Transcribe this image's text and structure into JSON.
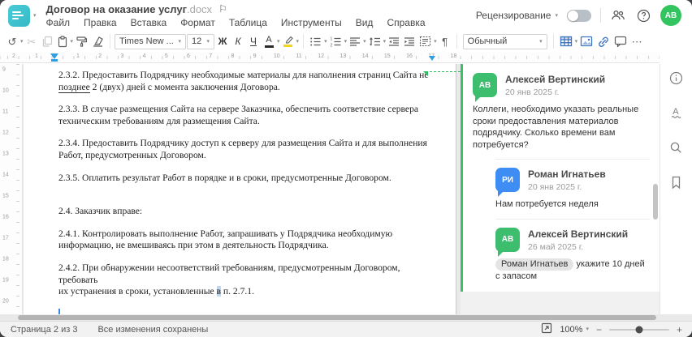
{
  "header": {
    "title": "Договор на оказание услуг",
    "title_ext": ".docx",
    "flag_icon": "⚐",
    "menu": [
      "Файл",
      "Правка",
      "Вставка",
      "Формат",
      "Таблица",
      "Инструменты",
      "Вид",
      "Справка"
    ],
    "review_label": "Рецензирование",
    "avatar_initials": "АВ"
  },
  "toolbar": {
    "font_name": "Times New ...",
    "font_size": "12",
    "bold_label": "Ж",
    "italic_label": "К",
    "underline_label": "Ч",
    "font_color_label": "А",
    "style_name": "Обычный",
    "pilcrow": "¶",
    "more": "⋯",
    "undo_glyph": "↺",
    "scissors_glyph": "✂"
  },
  "ruler": {
    "pre_numbers": [
      "2",
      "1"
    ],
    "numbers": [
      "1",
      "2",
      "3",
      "4",
      "5",
      "6",
      "7",
      "8",
      "9",
      "10",
      "11",
      "12",
      "13",
      "14",
      "15",
      "16",
      "17",
      "18"
    ],
    "v_numbers": [
      "9",
      "10",
      "11",
      "12",
      "13",
      "14",
      "15",
      "16",
      "17",
      "18",
      "19",
      "20"
    ],
    "marker_color": "#2f9ee3"
  },
  "document": {
    "paragraphs": [
      {
        "lines": [
          [
            {
              "t": "2.3.2. Предоставить Подрядчику необходимые материалы для наполнения страниц Сайта не"
            }
          ],
          [
            {
              "t": "позднее",
              "u": true
            },
            {
              "t": " 2 (двух) дней с момента заключения Договора."
            }
          ]
        ]
      },
      {
        "lines": [
          [
            {
              "t": "2.3.3. В случае размещения Сайта на сервере Заказчика, обеспечить соответствие сервера"
            }
          ],
          [
            {
              "t": "техническим требованиям для размещения Сайта."
            }
          ]
        ]
      },
      {
        "lines": [
          [
            {
              "t": "2.3.4. Предоставить Подрядчику доступ к серверу для размещения Сайта и для выполнения"
            }
          ],
          [
            {
              "t": "Работ, предусмотренных Договором."
            }
          ]
        ]
      },
      {
        "lines": [
          [
            {
              "t": "2.3.5. Оплатить результат Работ в порядке и в сроки, предусмотренные Договором."
            }
          ]
        ]
      },
      {
        "gap": true,
        "lines": [
          [
            {
              "t": "2.4. Заказчик вправе:"
            }
          ]
        ]
      },
      {
        "lines": [
          [
            {
              "t": "2.4.1. Контролировать выполнение Работ, запрашивать у Подрядчика необходимую"
            }
          ],
          [
            {
              "t": "информацию, не вмешиваясь при этом в деятельность Подрядчика."
            }
          ]
        ]
      },
      {
        "lines": [
          [
            {
              "t": "2.4.2. При обнаружении несоответствий требованиям, предусмотренным Договором, требовать"
            }
          ],
          [
            {
              "t": "их устранения в сроки, установленные "
            },
            {
              "t": "в",
              "hl": true
            },
            {
              "t": " п. 2.7.1."
            }
          ]
        ]
      }
    ]
  },
  "comments": {
    "accent_green": "#3dbe6b",
    "items": [
      {
        "author": "Алексей Вертинский",
        "initials": "АВ",
        "avatar_color": "#3dbd6e",
        "date": "20 янв 2025 г.",
        "text": "Коллеги, необходимо указать реальные сроки предоставления материалов подрядчику. Сколько времени вам потребуется?",
        "reply": false
      },
      {
        "author": "Роман Игнатьев",
        "initials": "РИ",
        "avatar_color": "#3d8df5",
        "date": "20 янв 2025 г.",
        "text": "Нам потребуется неделя",
        "reply": true
      },
      {
        "author": "Алексей Вертинский",
        "initials": "АВ",
        "avatar_color": "#3dbd6e",
        "date": "26 май 2025 г.",
        "mention": "Роман Игнатьев",
        "text": "укажите 10 дней с запасом",
        "reply": true
      }
    ]
  },
  "status_bar": {
    "page_info": "Страница 2 из 3",
    "saved_message": "Все изменения сохранены",
    "zoom_value": "100%",
    "zoom_out": "−",
    "zoom_in": "+"
  }
}
